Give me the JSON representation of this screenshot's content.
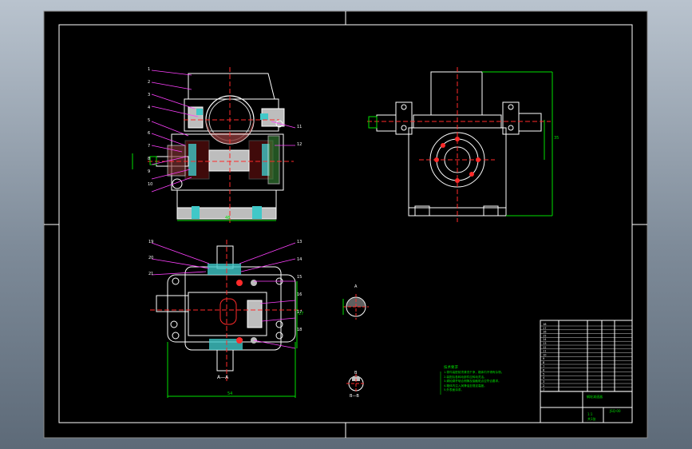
{
  "colors": {
    "background_top": "#b9c3ce",
    "sheet": "#000000",
    "line": "#ffffff",
    "centerline": "#ff2a2a",
    "dimension": "#00e000",
    "part_gray": "#cfcfcf",
    "hatch_cyan": "#40c8c8",
    "leader_magenta": "#ff40ff"
  },
  "drawing": {
    "section_label_a": "A—A",
    "section_label_b": "B—B",
    "view_label_a": "A",
    "view_label_b": "B",
    "dim_width_bottom": "54",
    "dim_height_right": "35",
    "dim_shaft_top": "48",
    "dim_side": "27"
  },
  "balloons_top_left": [
    "1",
    "2",
    "3",
    "4",
    "5",
    "6",
    "7",
    "8",
    "9",
    "10"
  ],
  "balloons_top_right": [
    "11",
    "12"
  ],
  "balloons_bottom_left": [
    "19",
    "20",
    "21"
  ],
  "balloons_bottom_right": [
    "13",
    "14",
    "15",
    "16",
    "17",
    "18"
  ],
  "technical_requirements": {
    "title": "技术要求",
    "lines": [
      "1.零件装配前须清洗干净，箱体内不得有杂物。",
      "2.装配后各转动部件应转动灵活。",
      "3.蜗轮蜗杆啮合侧隙及接触斑点应符合要求。",
      "4.箱体内注入润滑油至规定高度。",
      "5.外表面涂漆。"
    ]
  },
  "title_block": {
    "drawing_name": "蜗轮减速器",
    "drawing_no": "JSQ-00",
    "scale": "1:1",
    "sheet": "共1张"
  },
  "parts_list_rows": [
    "18",
    "17",
    "16",
    "15",
    "14",
    "13",
    "12",
    "11",
    "10",
    "9",
    "8",
    "7",
    "6",
    "5",
    "4",
    "3",
    "2",
    "1"
  ]
}
